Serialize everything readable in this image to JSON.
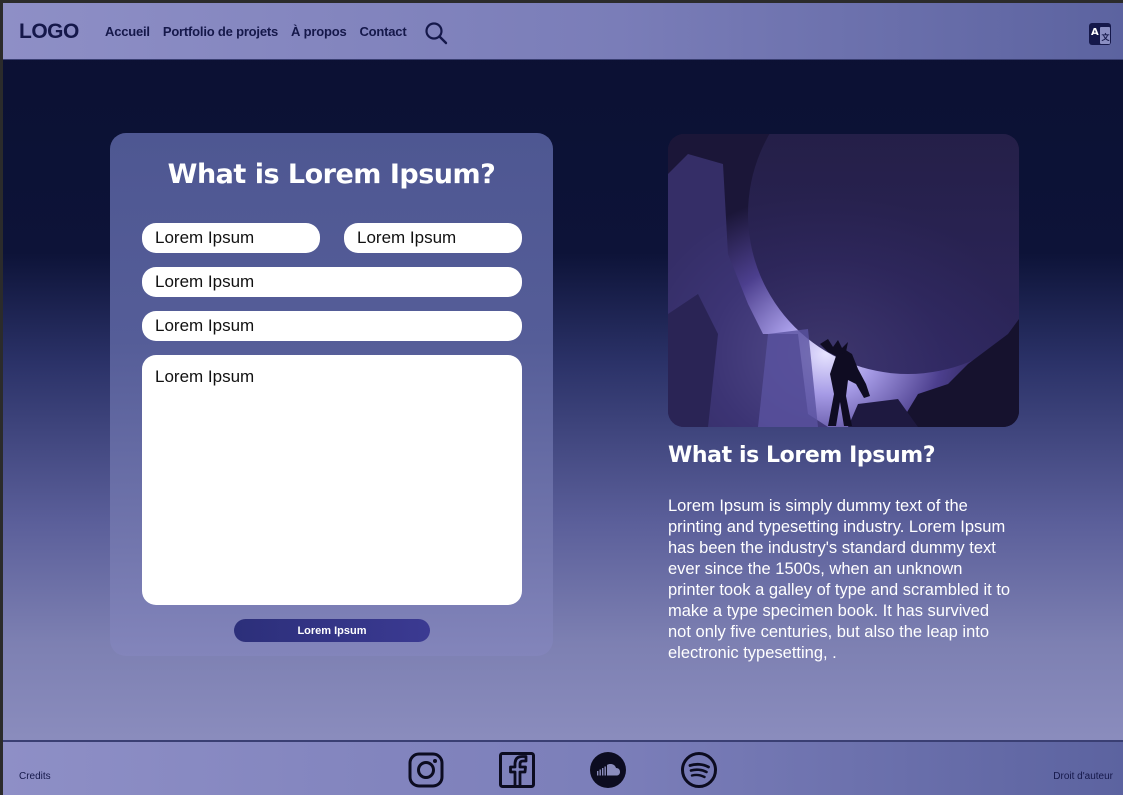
{
  "header": {
    "logo": "LOGO",
    "nav": [
      "Accueil",
      "Portfolio de projets",
      "À propos",
      "Contact"
    ]
  },
  "form": {
    "title": "What is Lorem Ipsum?",
    "fields": {
      "first": "Lorem Ipsum",
      "second": "Lorem Ipsum",
      "third": "Lorem Ipsum",
      "fourth": "Lorem Ipsum",
      "message": "Lorem Ipsum"
    },
    "submit_label": "Lorem Ipsum"
  },
  "article": {
    "title": "What is Lorem Ipsum?",
    "body": "Lorem Ipsum is simply dummy text of the printing and typesetting industry. Lorem Ipsum has been the industry's standard dummy text ever since the 1500s, when an unknown printer took a galley of type and scrambled it to make a type specimen book. It has survived not only five centuries, but also the leap into electronic typesetting, ."
  },
  "footer": {
    "credits": "Credits",
    "copyright": "Droit d'auteur",
    "social": [
      "instagram-icon",
      "facebook-icon",
      "soundcloud-icon",
      "spotify-icon"
    ]
  },
  "colors": {
    "header_bg": "#8e8fc6",
    "nav_text": "#15184a",
    "page_top": "#0b1032",
    "card_bg": "#555d98",
    "button_bg": "#2c2f7a"
  }
}
